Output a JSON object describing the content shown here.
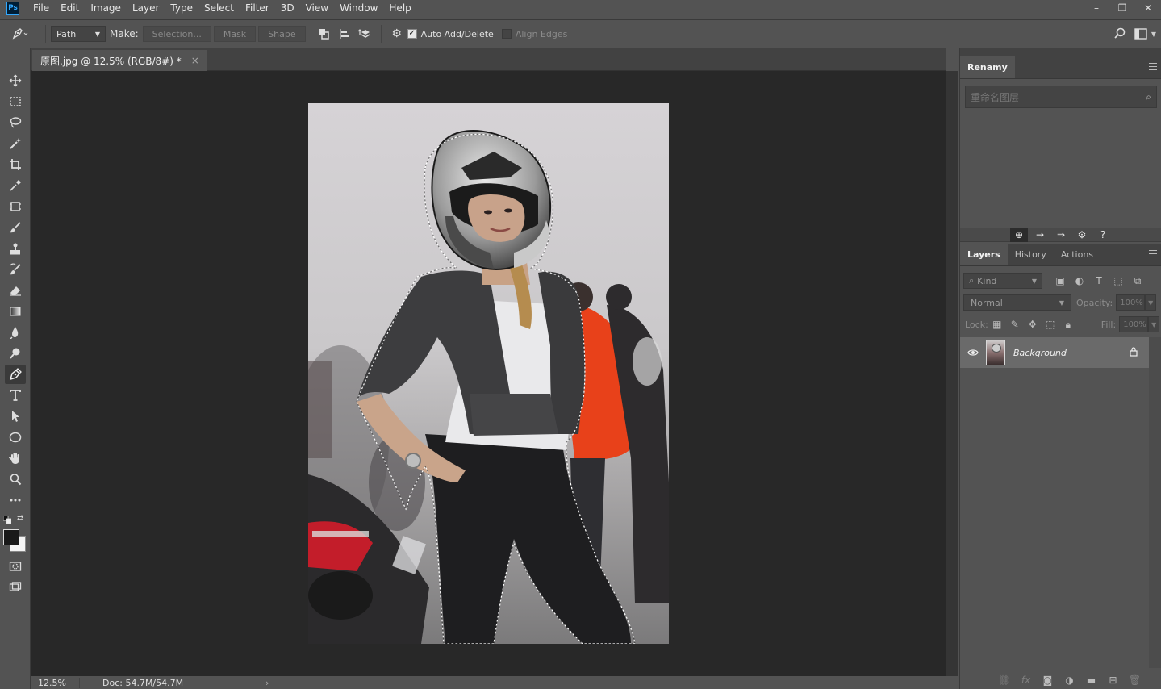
{
  "app": {
    "logo": "Ps"
  },
  "menu": [
    "File",
    "Edit",
    "Image",
    "Layer",
    "Type",
    "Select",
    "Filter",
    "3D",
    "View",
    "Window",
    "Help"
  ],
  "window_controls": {
    "minimize": "–",
    "restore": "❐",
    "close": "✕"
  },
  "options": {
    "mode": "Path",
    "make_label": "Make:",
    "selection_btn": "Selection...",
    "mask_btn": "Mask",
    "shape_btn": "Shape",
    "auto_add_delete": {
      "label": "Auto Add/Delete",
      "checked": true
    },
    "align_edges": {
      "label": "Align Edges",
      "checked": false
    }
  },
  "document": {
    "tab_title": "原图.jpg @ 12.5% (RGB/8#) *",
    "close": "×",
    "zoom": "12.5%",
    "doc_size": "Doc: 54.7M/54.7M",
    "status_arrow": "›"
  },
  "renamy": {
    "tab": "Renamy",
    "search_placeholder": "重命名图层",
    "tools": [
      "⊕",
      "→",
      "⇒",
      "⚙",
      "?"
    ]
  },
  "layers_panel": {
    "tabs": [
      "Layers",
      "History",
      "Actions"
    ],
    "active_tab": "Layers",
    "kind_label": "Kind",
    "blend_mode": "Normal",
    "opacity_label": "Opacity:",
    "opacity_value": "100%",
    "lock_label": "Lock:",
    "fill_label": "Fill:",
    "fill_value": "100%",
    "layers": [
      {
        "name": "Background",
        "visible": true,
        "locked": true
      }
    ]
  },
  "colors": {
    "ui_bg": "#535353",
    "canvas_bg": "#282828",
    "panel_dark": "#424242",
    "accent": "#31a8ff"
  }
}
